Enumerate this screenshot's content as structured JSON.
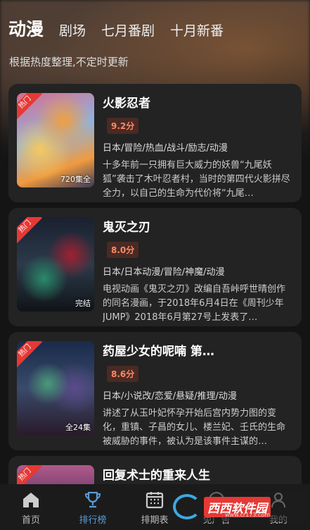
{
  "header": {
    "tabs": [
      {
        "label": "动漫",
        "active": true
      },
      {
        "label": "剧场",
        "active": false
      },
      {
        "label": "七月番剧",
        "active": false
      },
      {
        "label": "十月新番",
        "active": false
      }
    ],
    "subtitle": "根据热度整理,不定时更新"
  },
  "cards": [
    {
      "badge": "热门",
      "title": "火影忍者",
      "score": "9.2分",
      "episodes": "720集全",
      "tags": "日本/冒险/热血/战斗/励志/动漫",
      "desc": "十多年前一只拥有巨大威力的妖兽“九尾妖狐”袭击了木叶忍者村，当时的第四代火影拼尽全力，以自己的生命为代价将“九尾…"
    },
    {
      "badge": "热门",
      "title": "鬼灭之刃",
      "score": "8.0分",
      "episodes": "完结",
      "tags": "日本/日本动漫/冒险/神魔/动漫",
      "desc": "电视动画《鬼灭之刃》改编自吾峠呼世晴创作的同名漫画，于2018年6月4日在《周刊少年JUMP》2018年6月第27号上发表了…"
    },
    {
      "badge": "热门",
      "title": "药屋少女的呢喃 第…",
      "score": "8.6分",
      "episodes": "全24集",
      "tags": "日本/小说改/恋爱/悬疑/推理/动漫",
      "desc": "讲述了从玉叶妃怀孕开始后宫内势力图的变化，重镇、子昌的女儿、楼兰妃、壬氏的生命被威胁的事件，被认为是该事件主谋的…"
    },
    {
      "badge": "热门",
      "title": "回复术士的重来人生"
    }
  ],
  "nav": {
    "items": [
      {
        "label": "首页",
        "icon": "home-icon"
      },
      {
        "label": "排行榜",
        "icon": "trophy-icon"
      },
      {
        "label": "排期表",
        "icon": "calendar-icon"
      },
      {
        "label": "免广告",
        "icon": "no-ads-icon"
      },
      {
        "label": "我的",
        "icon": "user-icon"
      }
    ]
  },
  "watermark": {
    "text": "西西软件园",
    "url": "www.cr173.com"
  },
  "colors": {
    "accent": "#5b9bd5",
    "hot": "#e53935",
    "score": "#ff8a65"
  }
}
